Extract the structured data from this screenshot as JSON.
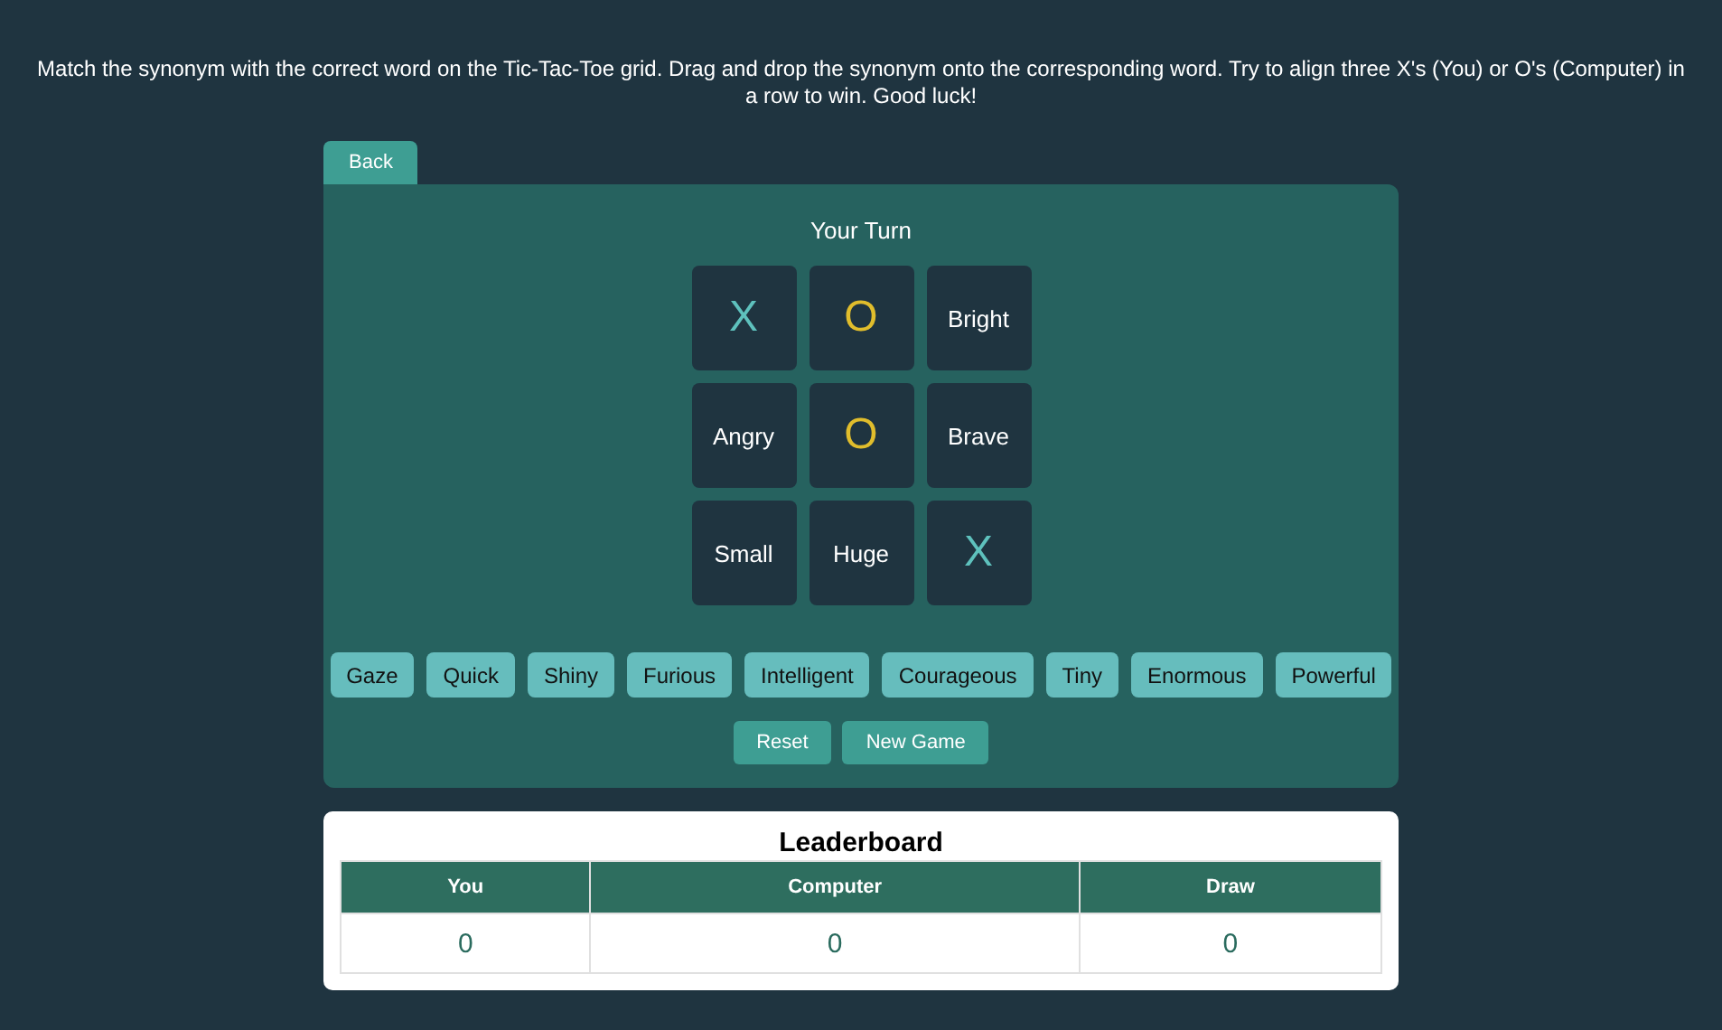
{
  "instructions": "Match the synonym with the correct word on the Tic-Tac-Toe grid. Drag and drop the synonym onto the corresponding word. Try to align three X's (You) or O's (Computer) in a row to win. Good luck!",
  "back_button": "Back",
  "turn": "Your Turn",
  "grid": [
    {
      "kind": "x",
      "text": "X"
    },
    {
      "kind": "o",
      "text": "O"
    },
    {
      "kind": "word",
      "text": "Bright"
    },
    {
      "kind": "word",
      "text": "Angry"
    },
    {
      "kind": "o",
      "text": "O"
    },
    {
      "kind": "word",
      "text": "Brave"
    },
    {
      "kind": "word",
      "text": "Small"
    },
    {
      "kind": "word",
      "text": "Huge"
    },
    {
      "kind": "x",
      "text": "X"
    }
  ],
  "synonyms": [
    "Gaze",
    "Quick",
    "Shiny",
    "Furious",
    "Intelligent",
    "Courageous",
    "Tiny",
    "Enormous",
    "Powerful"
  ],
  "actions": [
    "Reset",
    "New Game"
  ],
  "leaderboard": {
    "title": "Leaderboard",
    "columns": [
      "You",
      "Computer",
      "Draw"
    ],
    "values": [
      "0",
      "0",
      "0"
    ]
  }
}
